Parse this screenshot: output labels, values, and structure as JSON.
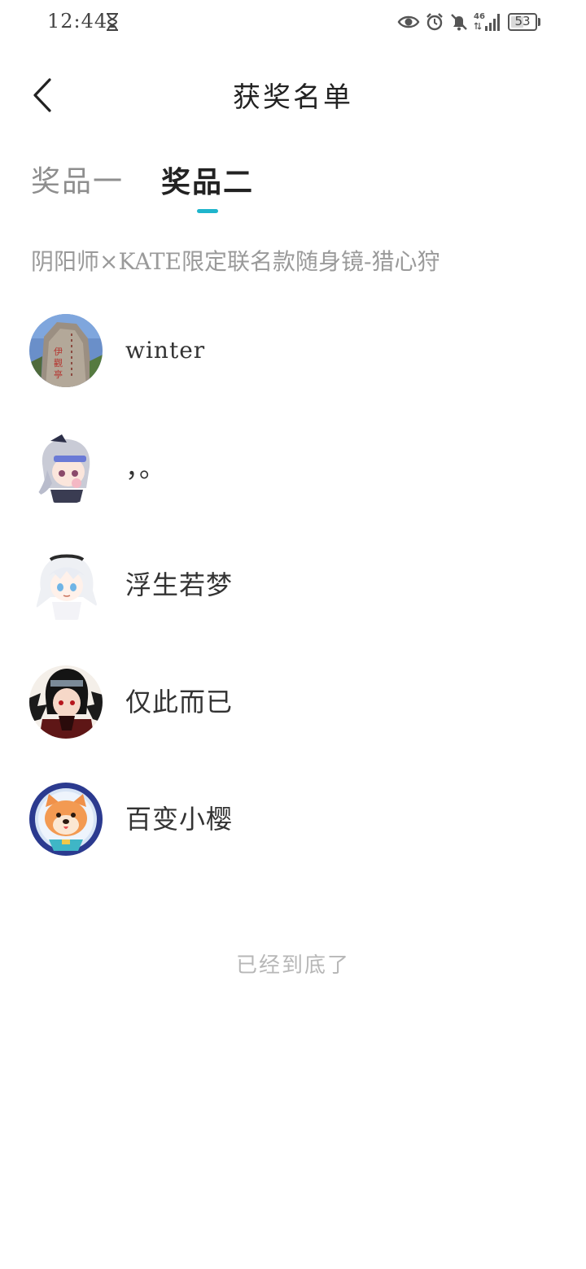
{
  "status_bar": {
    "time": "12:44",
    "network": "46",
    "battery": "53",
    "battery_level": 0.53
  },
  "header": {
    "title": "获奖名单"
  },
  "tabs": [
    {
      "label": "奖品一",
      "active": false
    },
    {
      "label": "奖品二",
      "active": true
    }
  ],
  "prize": {
    "name": "阴阳师×KATE限定联名款随身镜-猎心狩"
  },
  "winners": [
    {
      "name": "winter",
      "avatar": "rock-photo"
    },
    {
      "name": "，。",
      "avatar": "anime-girl-goggles"
    },
    {
      "name": "浮生若梦",
      "avatar": "anime-girl-white-hair"
    },
    {
      "name": "仅此而已",
      "avatar": "anime-character-dark"
    },
    {
      "name": "百变小樱",
      "avatar": "shiba-dog-astronaut"
    }
  ],
  "footer": {
    "end_text": "已经到底了"
  },
  "colors": {
    "accent": "#1fb5cc",
    "text_primary": "#222222",
    "text_muted": "#9a9a9a",
    "text_end": "#b7b7b7"
  }
}
